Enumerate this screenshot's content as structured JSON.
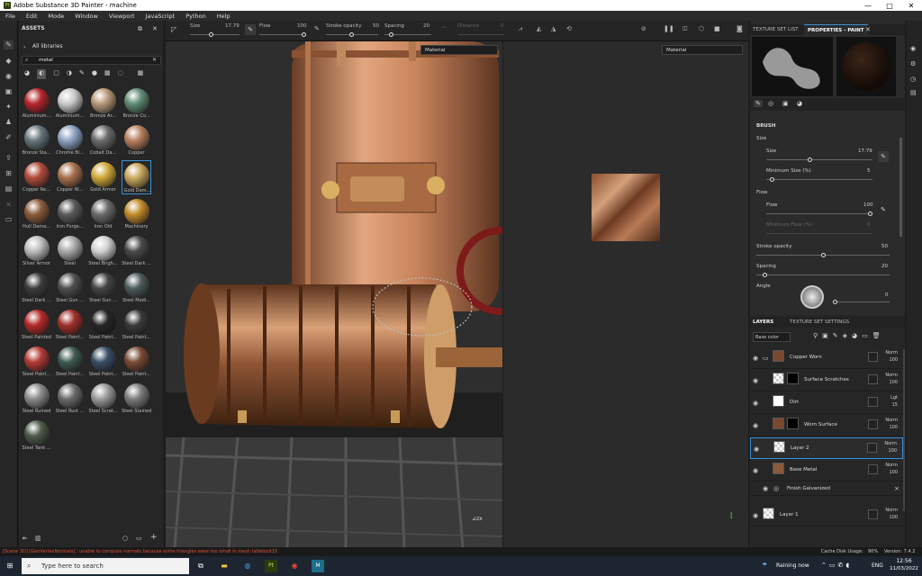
{
  "window": {
    "title": "Adobe Substance 3D Painter - machine",
    "app_badge": "Pt",
    "minimize": "—",
    "maximize": "□",
    "close": "✕"
  },
  "menu": [
    "File",
    "Edit",
    "Mode",
    "Window",
    "Viewport",
    "JavaScript",
    "Python",
    "Help"
  ],
  "toolbar": {
    "size_label": "Size",
    "size_value": "17.79",
    "flow_label": "Flow",
    "flow_value": "100",
    "stroke_opacity_label": "Stroke opacity",
    "stroke_opacity_value": "50",
    "spacing_label": "Spacing",
    "spacing_value": "20",
    "distance_label": "Distance",
    "distance_value": "0",
    "view_mode": "Material",
    "view_mode_2d": "Material"
  },
  "assets": {
    "title": "ASSETS",
    "library": "All libraries",
    "search_value": "metal",
    "items": [
      {
        "label": "Aluminium...",
        "color": "#b3262b"
      },
      {
        "label": "Aluminium...",
        "color": "#c9c9c9"
      },
      {
        "label": "Bronze Ar...",
        "color": "#b9987a"
      },
      {
        "label": "Bronze Co...",
        "color": "#5e8a74"
      },
      {
        "label": "Bronze Sta...",
        "color": "#66757a"
      },
      {
        "label": "Chrome Bl...",
        "color": "#8ea2c0"
      },
      {
        "label": "Cobalt Da...",
        "color": "#6a6a6a"
      },
      {
        "label": "Copper",
        "color": "#b77f5e"
      },
      {
        "label": "Copper Re...",
        "color": "#b24b3b"
      },
      {
        "label": "Copper W...",
        "color": "#a8704e"
      },
      {
        "label": "Gold Armor",
        "color": "#d1a93a"
      },
      {
        "label": "Gold Dam...",
        "color": "#c7a55a"
      },
      {
        "label": "Hull Dama...",
        "color": "#8a5a3a"
      },
      {
        "label": "Iron Forge...",
        "color": "#5a5a5a"
      },
      {
        "label": "Iron Old",
        "color": "#6b6b6b"
      },
      {
        "label": "Machinery",
        "color": "#c28a2a"
      },
      {
        "label": "Silver Armor",
        "color": "#bdbdbd"
      },
      {
        "label": "Steel",
        "color": "#a9a9a9"
      },
      {
        "label": "Steel Brigh...",
        "color": "#d0d0d0"
      },
      {
        "label": "Steel Dark ...",
        "color": "#4a4a4a"
      },
      {
        "label": "Steel Dark ...",
        "color": "#3c3c3c"
      },
      {
        "label": "Steel Gun ...",
        "color": "#4f4f4f"
      },
      {
        "label": "Steel Gun ...",
        "color": "#444"
      },
      {
        "label": "Steel Medi...",
        "color": "#4d5a5a"
      },
      {
        "label": "Steel Painted",
        "color": "#b52a2a"
      },
      {
        "label": "Steel Paint...",
        "color": "#a0302a"
      },
      {
        "label": "Steel Paint...",
        "color": "#262626"
      },
      {
        "label": "Steel Paint...",
        "color": "#3a3a3a"
      },
      {
        "label": "Steel Paint...",
        "color": "#b33a35"
      },
      {
        "label": "Steel Paint...",
        "color": "#3f5a52"
      },
      {
        "label": "Steel Paint...",
        "color": "#3a4e66"
      },
      {
        "label": "Steel Paint...",
        "color": "#7a4a35"
      },
      {
        "label": "Steel Ruined",
        "color": "#8a8a8a"
      },
      {
        "label": "Steel Rust ...",
        "color": "#6a6a6a"
      },
      {
        "label": "Steel Scrat...",
        "color": "#9a9a9a"
      },
      {
        "label": "Steel Stained",
        "color": "#7b7b7b"
      },
      {
        "label": "Steel Tank ...",
        "color": "#4f5a4a"
      }
    ]
  },
  "right_tabs": {
    "texture_set_list": "TEXTURE SET LIST",
    "properties": "PROPERTIES - PAINT"
  },
  "brush": {
    "section": "BRUSH",
    "size_group": "Size",
    "size_label": "Size",
    "size_value": "17.79",
    "min_size_label": "Minimum Size (%)",
    "min_size_value": "5",
    "flow_group": "Flow",
    "flow_label": "Flow",
    "flow_value": "100",
    "min_flow_label": "Minimum Flow (%)",
    "min_flow_value": "0",
    "stroke_opacity_label": "Stroke opacity",
    "stroke_opacity_value": "50",
    "spacing_label": "Spacing",
    "spacing_value": "20",
    "angle_label": "Angle",
    "angle_value": "0"
  },
  "layers_panel": {
    "tab_layers": "LAYERS",
    "tab_tss": "TEXTURE SET SETTINGS",
    "channel": "Base color",
    "rows": [
      {
        "name": "Copper Worn",
        "blend": "Norm",
        "opacity": "100"
      },
      {
        "name": "Surface Scratches",
        "blend": "Norm",
        "opacity": "100"
      },
      {
        "name": "Dirt",
        "blend": "Lgt",
        "opacity": "15"
      },
      {
        "name": "Worn Surface",
        "blend": "Norm",
        "opacity": "100"
      },
      {
        "name": "Layer 2",
        "blend": "Norm",
        "opacity": "100"
      },
      {
        "name": "Base Metal",
        "blend": "Norm",
        "opacity": "100"
      },
      {
        "name": "Finish Galvanized",
        "blend": "",
        "opacity": ""
      },
      {
        "name": "Layer 1",
        "blend": "Norm",
        "opacity": "100"
      }
    ]
  },
  "status": {
    "error": "[Scene 3D] [GenVertexNormals] : unable to compute normals because some triangles were too small in mesh tablebolt15",
    "cache": "Cache Disk Usage:",
    "cache_value": "90%",
    "version": "Version: 7.4.2"
  },
  "taskbar": {
    "search_placeholder": "Type here to search",
    "weather": "Raining now",
    "lang": "ENG",
    "time": "12:56",
    "date": "11/03/2022"
  }
}
